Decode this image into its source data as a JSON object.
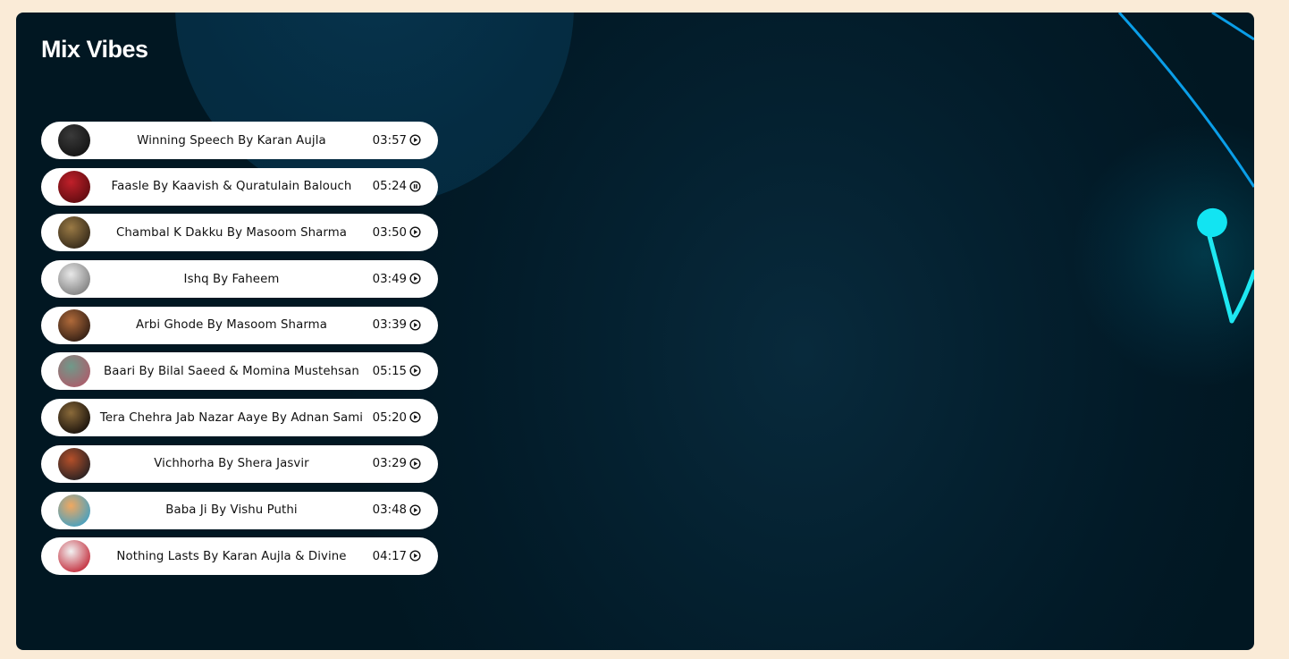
{
  "section": {
    "title": "Mix Vibes"
  },
  "colors": {
    "page_bg": "#faebd7",
    "card_bg": "#021a27",
    "accent": "#00e0ff",
    "row_bg": "#ffffff"
  },
  "tracks": [
    {
      "title": "Winning Speech By Karan Aujla",
      "duration": "03:57",
      "state": "play",
      "thumb_colors": [
        "#3a3a3a",
        "#111111"
      ]
    },
    {
      "title": "Faasle By Kaavish & Quratulain Balouch",
      "duration": "05:24",
      "state": "pause",
      "thumb_colors": [
        "#c0202a",
        "#5a0a0e"
      ]
    },
    {
      "title": "Chambal K Dakku By Masoom Sharma",
      "duration": "03:50",
      "state": "play",
      "thumb_colors": [
        "#9a7a45",
        "#2e2416"
      ]
    },
    {
      "title": "Ishq By Faheem",
      "duration": "03:49",
      "state": "play",
      "thumb_colors": [
        "#e8e8e8",
        "#7a7a7a"
      ]
    },
    {
      "title": "Arbi Ghode By Masoom Sharma",
      "duration": "03:39",
      "state": "play",
      "thumb_colors": [
        "#b06a3a",
        "#2a1a12"
      ]
    },
    {
      "title": "Baari By Bilal Saeed & Momina Mustehsan",
      "duration": "05:15",
      "state": "play",
      "thumb_colors": [
        "#6f9a8a",
        "#b05a6a"
      ]
    },
    {
      "title": "Tera Chehra Jab Nazar Aaye By Adnan Sami",
      "duration": "05:20",
      "state": "play",
      "thumb_colors": [
        "#8a6a3a",
        "#120c08"
      ]
    },
    {
      "title": "Vichhorha By Shera Jasvir",
      "duration": "03:29",
      "state": "play",
      "thumb_colors": [
        "#b5502a",
        "#1e1e22"
      ]
    },
    {
      "title": "Baba Ji By Vishu Puthi",
      "duration": "03:48",
      "state": "play",
      "thumb_colors": [
        "#f0a860",
        "#3aa0c8"
      ]
    },
    {
      "title": "Nothing Lasts By Karan Aujla & Divine",
      "duration": "04:17",
      "state": "play",
      "thumb_colors": [
        "#f2f2f2",
        "#c02030"
      ]
    }
  ]
}
